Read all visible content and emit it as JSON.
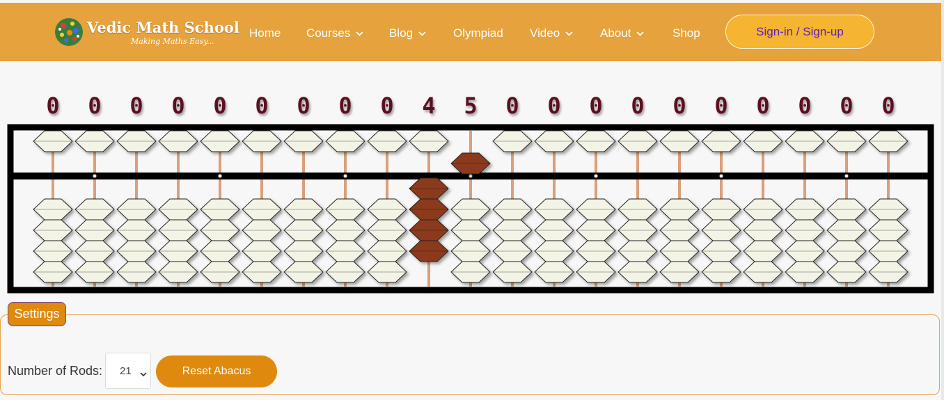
{
  "brand": {
    "name": "Vedic Math School",
    "tagline": "Making Maths Easy..."
  },
  "nav": [
    {
      "label": "Home",
      "has_dropdown": false
    },
    {
      "label": "Courses",
      "has_dropdown": true
    },
    {
      "label": "Blog",
      "has_dropdown": true
    },
    {
      "label": "Olympiad",
      "has_dropdown": false
    },
    {
      "label": "Video",
      "has_dropdown": true
    },
    {
      "label": "About",
      "has_dropdown": true
    },
    {
      "label": "Shop",
      "has_dropdown": false
    }
  ],
  "signin_label": "Sign-in / Sign-up",
  "abacus": {
    "rod_count": 21,
    "digits": [
      "0",
      "0",
      "0",
      "0",
      "0",
      "0",
      "0",
      "0",
      "0",
      "4",
      "5",
      "0",
      "0",
      "0",
      "0",
      "0",
      "0",
      "0",
      "0",
      "0",
      "0"
    ],
    "rod_values": [
      0,
      0,
      0,
      0,
      0,
      0,
      0,
      0,
      0,
      4,
      5,
      0,
      0,
      0,
      0,
      0,
      0,
      0,
      0,
      0,
      0
    ],
    "active_bead_color": "#8b3a1a",
    "inactive_bead_color": "#f4f4e6",
    "frame_color": "#000000",
    "rod_color": "#d9a07a"
  },
  "settings": {
    "title": "Settings",
    "rods_label": "Number of Rods:",
    "rods_value": "21",
    "reset_label": "Reset Abacus"
  },
  "colors": {
    "header": "#e6a23c",
    "accent": "#df8a0f",
    "signin_bg": "#f5b531",
    "signin_text": "#5b21b6"
  }
}
